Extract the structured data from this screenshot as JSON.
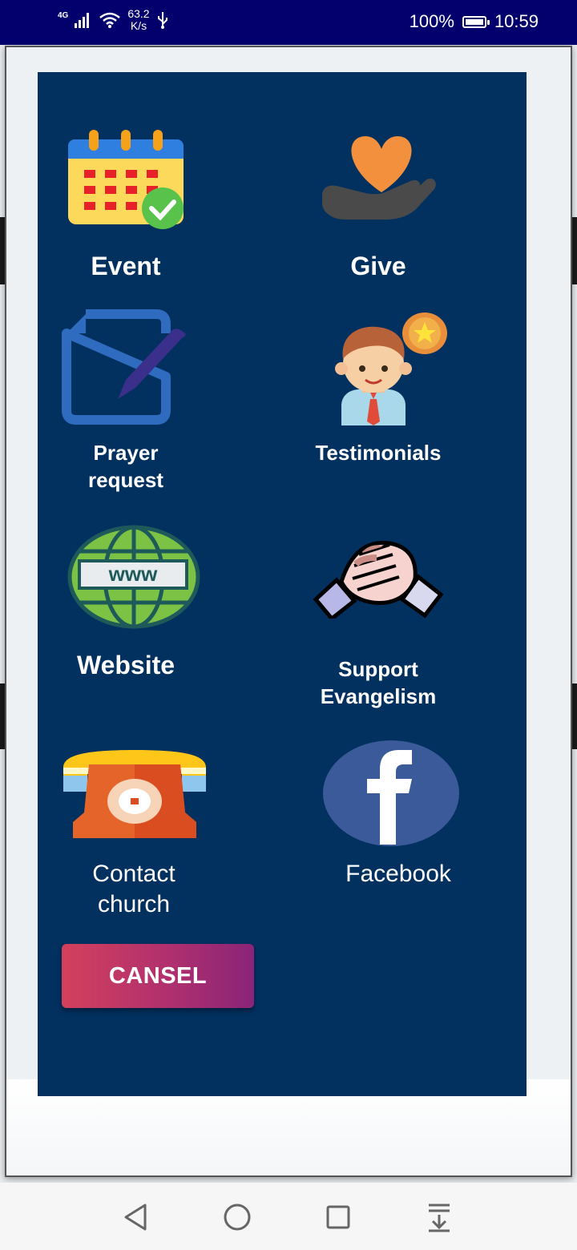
{
  "status_bar": {
    "network": "4G",
    "speed_value": "63.2",
    "speed_unit": "K/s",
    "battery": "100%",
    "time": "10:59"
  },
  "menu": {
    "items": [
      {
        "label": "Event",
        "icon": "calendar-check-icon"
      },
      {
        "label": "Give",
        "icon": "heart-in-hand-icon"
      },
      {
        "label": "Prayer request",
        "icon": "document-pen-icon"
      },
      {
        "label": "Testimonials",
        "icon": "person-star-icon"
      },
      {
        "label": "Website",
        "icon": "globe-www-icon"
      },
      {
        "label": "Support Evangelism",
        "icon": "handshake-icon"
      },
      {
        "label": "Contact church",
        "icon": "telephone-icon"
      },
      {
        "label": "Facebook",
        "icon": "facebook-icon"
      }
    ],
    "cancel_label": "CANSEL"
  },
  "colors": {
    "status_bar": "#03006e",
    "panel": "#02305f",
    "cancel_gradient_start": "#d3405c",
    "cancel_gradient_end": "#8a2478"
  },
  "nav_bar": {
    "buttons": [
      "back-icon",
      "home-icon",
      "recents-icon",
      "notification-pull-icon"
    ]
  }
}
